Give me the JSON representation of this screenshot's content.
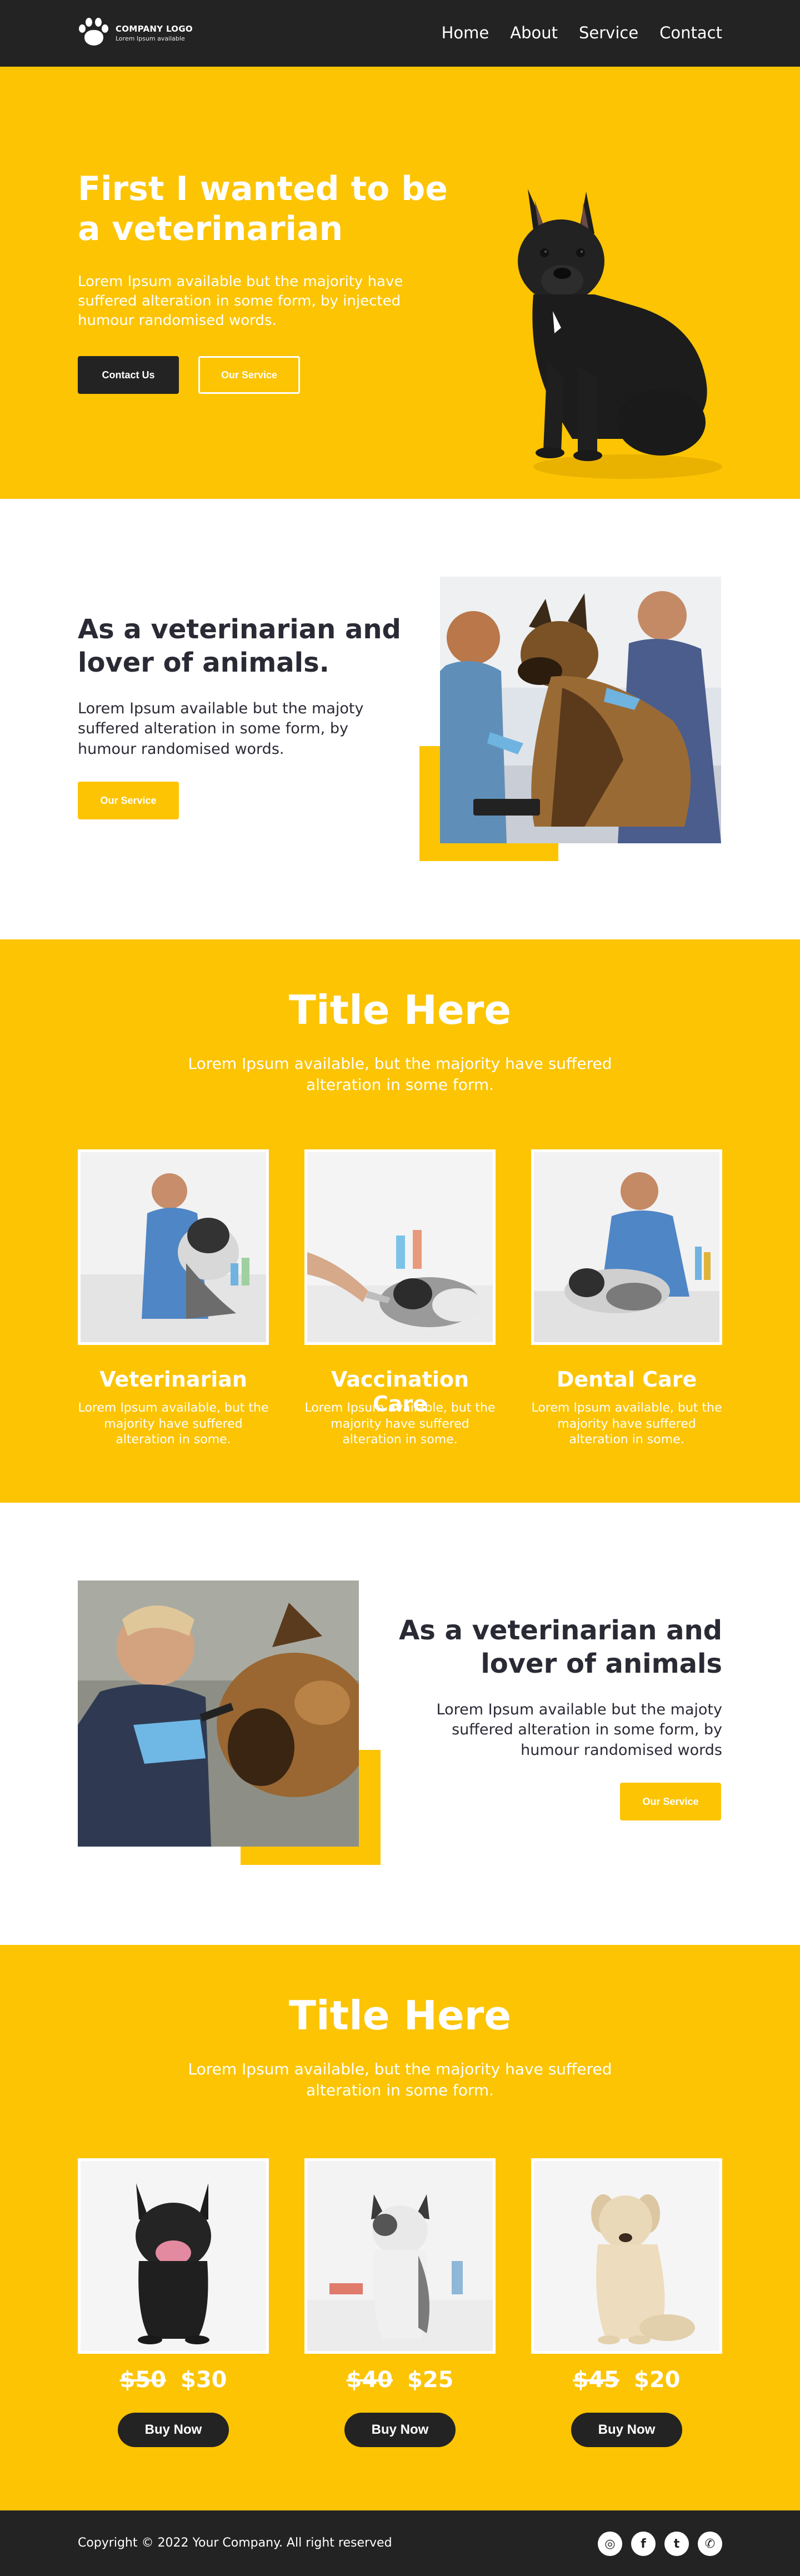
{
  "header": {
    "logo_name": "COMPANY LOGO",
    "logo_tagline": "Lorem Ipsum available",
    "nav": [
      {
        "label": "Home"
      },
      {
        "label": "About"
      },
      {
        "label": "Service"
      },
      {
        "label": "Contact"
      }
    ]
  },
  "hero": {
    "title": "First I wanted to be a veterinarian",
    "text": "Lorem Ipsum available but the majority have suffered alteration in some form, by injected humour randomised words.",
    "contact_button": "Contact Us",
    "service_button": "Our Service"
  },
  "about1": {
    "title": "As a veterinarian and lover of animals.",
    "text": "Lorem Ipsum available but the majoty suffered alteration in some form, by humour randomised words.",
    "button": "Our Service"
  },
  "services": {
    "title": "Title Here",
    "subtitle": "Lorem Ipsum available, but the majority have suffered alteration in some form.",
    "cards": [
      {
        "title": "Veterinarian",
        "text": "Lorem Ipsum available, but the majority have suffered alteration in some."
      },
      {
        "title": "Vaccination Care",
        "text": "Lorem Ipsum available, but the majority have suffered alteration in some."
      },
      {
        "title": "Dental Care",
        "text": "Lorem Ipsum available, but the majority have suffered alteration in some."
      }
    ]
  },
  "about2": {
    "title": "As a veterinarian and lover of animals",
    "text": "Lorem Ipsum available but the majoty suffered alteration in some form, by humour randomised words",
    "button": "Our Service"
  },
  "shop": {
    "title": "Title Here",
    "subtitle": "Lorem Ipsum available, but the majority have suffered alteration in some form.",
    "products": [
      {
        "old_price": "$50",
        "price": "$30",
        "button": "Buy Now"
      },
      {
        "old_price": "$40",
        "price": "$25",
        "button": "Buy Now"
      },
      {
        "old_price": "$45",
        "price": "$20",
        "button": "Buy Now"
      }
    ]
  },
  "footer": {
    "copyright": "Copyright © 2022 Your Company. All right reserved",
    "socials": [
      {
        "icon": "instagram-icon",
        "glyph": "◎"
      },
      {
        "icon": "facebook-icon",
        "glyph": "f"
      },
      {
        "icon": "twitter-icon",
        "glyph": "t"
      },
      {
        "icon": "whatsapp-icon",
        "glyph": "✆"
      }
    ]
  },
  "colors": {
    "accent": "#fcc403",
    "dark": "#232323",
    "text": "#2a2a35"
  }
}
